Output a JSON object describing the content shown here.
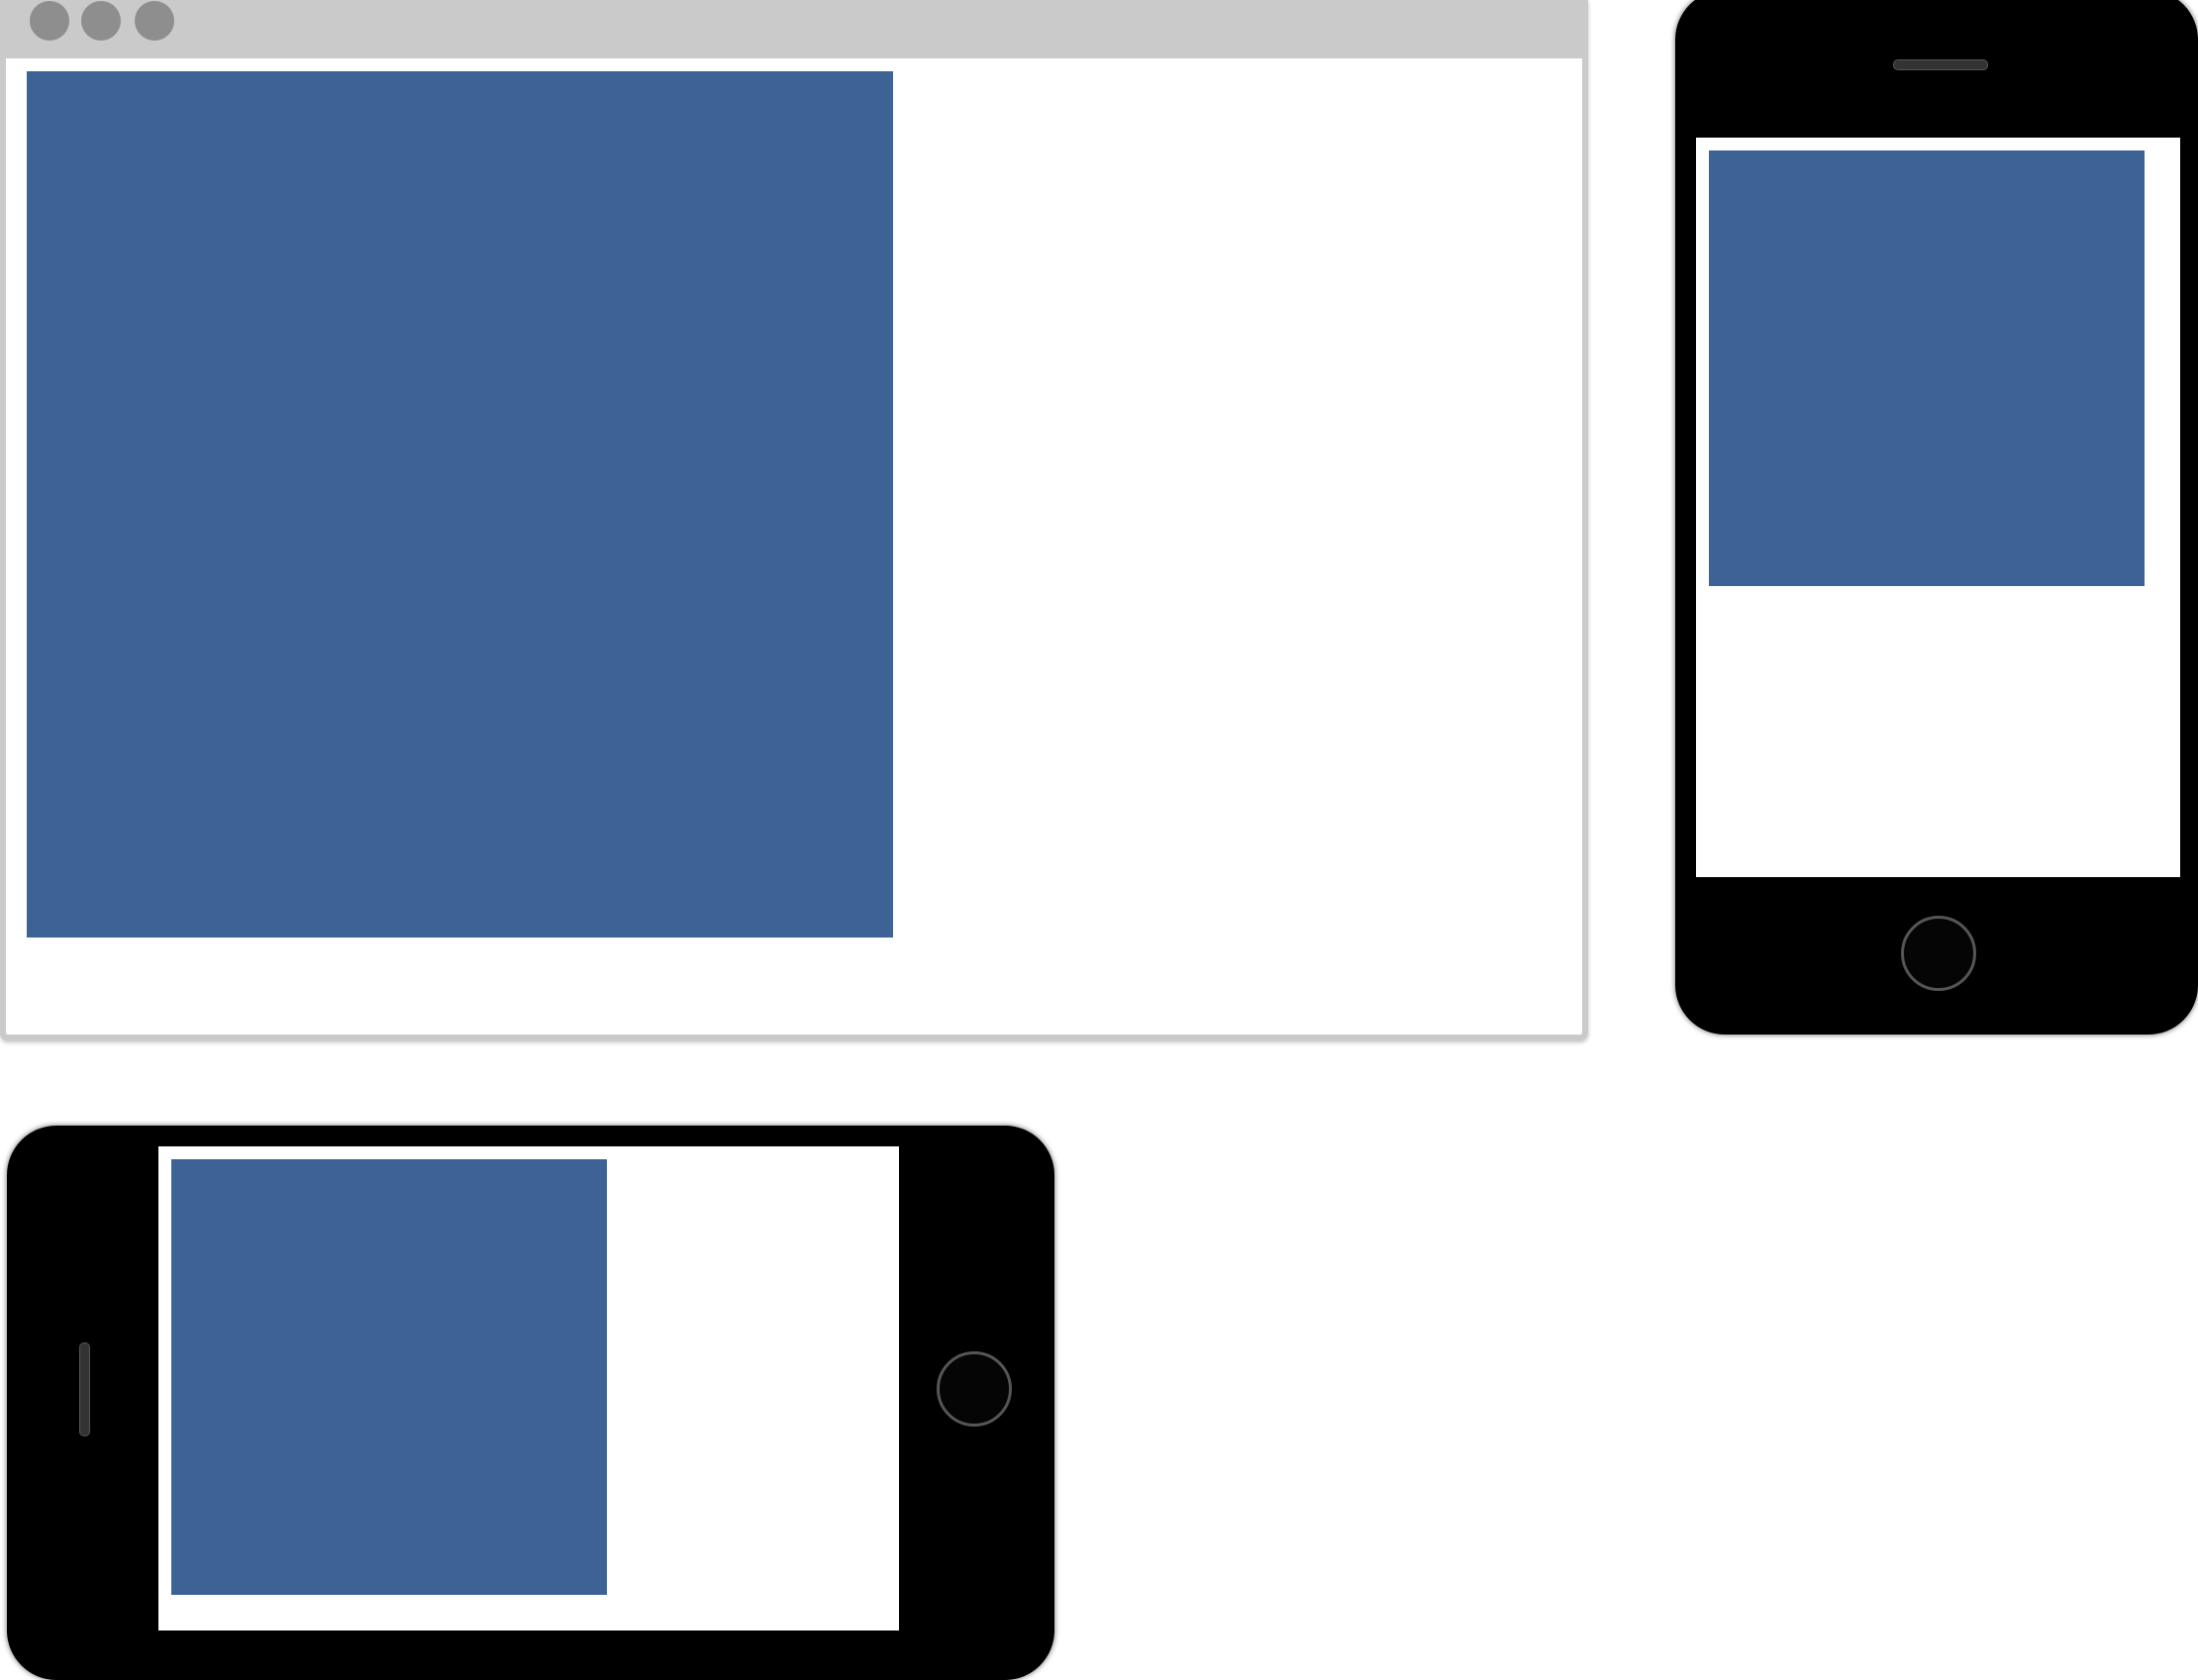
{
  "colors": {
    "content_block": "#3d6296",
    "browser_chrome": "#cacaca",
    "window_dots": "#8e8e8e",
    "phone_body": "#000000",
    "screen": "#ffffff"
  },
  "devices": [
    {
      "type": "desktop-browser",
      "icon": "browser-window-icon"
    },
    {
      "type": "phone-portrait",
      "icon": "phone-portrait-icon"
    },
    {
      "type": "phone-landscape",
      "icon": "phone-landscape-icon"
    }
  ]
}
